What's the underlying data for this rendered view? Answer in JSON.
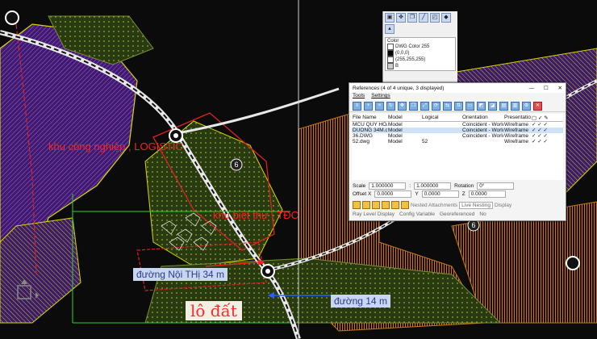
{
  "annotations": {
    "industrial": "khu công nghiệp , LOGISTIC",
    "villa": "khu biệt thự , TĐC",
    "road_34": "đường Nội THị 34 m",
    "road_14": "đường 14 m",
    "plot": "lô đất"
  },
  "map_markers": {
    "route_1": "6",
    "route_2": "6"
  },
  "palette": {
    "color_header": "Color",
    "color_options": [
      "DWG Color 255",
      "(0,0,0)",
      "(255,255,255)",
      "B"
    ]
  },
  "references_window": {
    "title": "References (4 of 4 unique, 3 displayed)",
    "menu": [
      "Tools",
      "Settings"
    ],
    "columns": [
      "File Name",
      "Model",
      "Logical",
      "Orientation",
      "Presentation"
    ],
    "rows": [
      {
        "file": "MCU QUY HOA...",
        "model": "Model",
        "logical": "",
        "orientation": "Coincident - World",
        "presentation": "Wireframe"
      },
      {
        "file": "DUONG 34M.dwg",
        "model": "Model",
        "logical": "",
        "orientation": "Coincident - World",
        "presentation": "Wireframe"
      },
      {
        "file": "36.DWG",
        "model": "Model",
        "logical": "",
        "orientation": "Coincident - World",
        "presentation": "Wireframe"
      },
      {
        "file": "52.dwg",
        "model": "Model",
        "logical": "52",
        "orientation": "",
        "presentation": "Wireframe"
      }
    ],
    "scale_label": "Scale",
    "scale_value_1": "1.000000",
    "scale_value_2": "1.000000",
    "rotation_label": "Rotation",
    "rotation_value": "0°",
    "offset_x_label": "Offset X",
    "offset_x_value": "0.0000",
    "offset_y_label": "Y",
    "offset_y_value": "0.0000",
    "offset_z_label": "Z",
    "offset_z_value": "0.0000",
    "nested_label": "Nested Attachments",
    "nested_value": "Live Nesting",
    "display_label": "Display",
    "status_items": [
      "Ray Level Display",
      "Config Variable",
      "Georeferenced",
      "No"
    ]
  },
  "colors": {
    "purple": "#5b1f8f",
    "yellow": "#d8d800",
    "orange": "#c87818",
    "red_line": "#e02020",
    "road_white": "#ffffff"
  }
}
